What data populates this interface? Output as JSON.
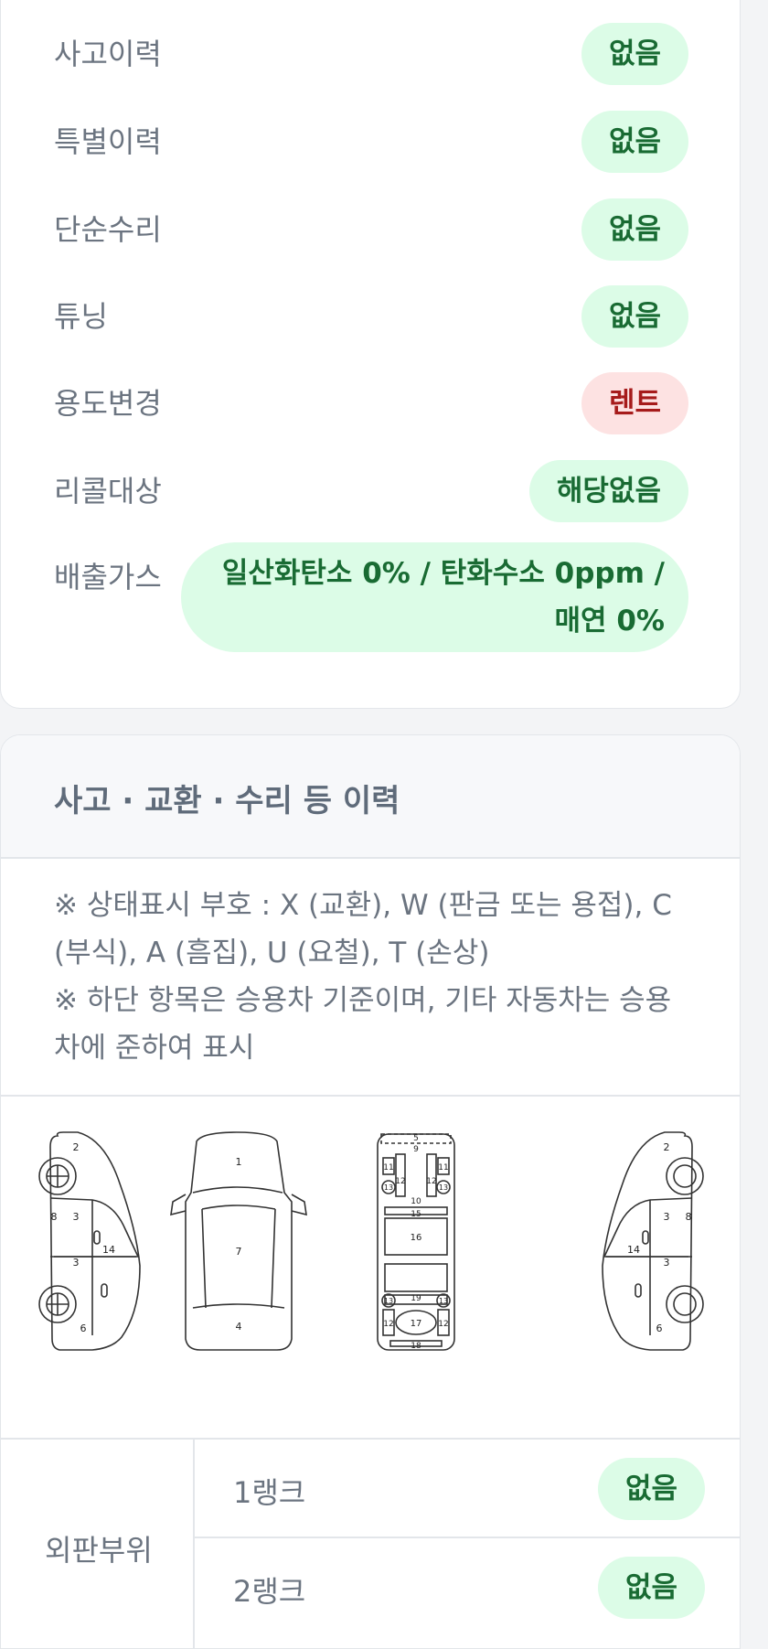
{
  "history": {
    "rows": [
      {
        "label": "사고이력",
        "value": "없음",
        "status": "green"
      },
      {
        "label": "특별이력",
        "value": "없음",
        "status": "green"
      },
      {
        "label": "단순수리",
        "value": "없음",
        "status": "green"
      },
      {
        "label": "튜닝",
        "value": "없음",
        "status": "green"
      },
      {
        "label": "용도변경",
        "value": "렌트",
        "status": "red"
      },
      {
        "label": "리콜대상",
        "value": "해당없음",
        "status": "green"
      },
      {
        "label": "배출가스",
        "value": "일산화탄소 0% / 탄화수소 0ppm / 매연 0%",
        "status": "green"
      }
    ]
  },
  "section": {
    "title": "사고 · 교환 · 수리 등 이력",
    "notes": [
      "※ 상태표시 부호 : X (교환), W (판금 또는 용접), C (부식), A (흠집), U (요철), T (손상)",
      "※ 하단 항목은 승용차 기준이며, 기타 자동차는 승용차에 준하여 표시"
    ]
  },
  "diagram": {
    "left_side": [
      "2",
      "8",
      "3",
      "3",
      "14",
      "6"
    ],
    "top_view": [
      "1",
      "7",
      "4"
    ],
    "frame": [
      "5",
      "9",
      "11",
      "11",
      "12",
      "12",
      "13",
      "13",
      "10",
      "15",
      "16",
      "19",
      "13",
      "13",
      "12",
      "17",
      "12",
      "18"
    ],
    "right_side": [
      "2",
      "3",
      "8",
      "14",
      "3",
      "6"
    ]
  },
  "outer_panel": {
    "group_label": "외판부위",
    "ranks": [
      {
        "label": "1랭크",
        "value": "없음"
      },
      {
        "label": "2랭크",
        "value": "없음"
      }
    ]
  },
  "colors": {
    "green_bg": "#dcfce7",
    "green_text": "#196b33",
    "red_bg": "#fde2e2",
    "red_text": "#a61b1b"
  }
}
